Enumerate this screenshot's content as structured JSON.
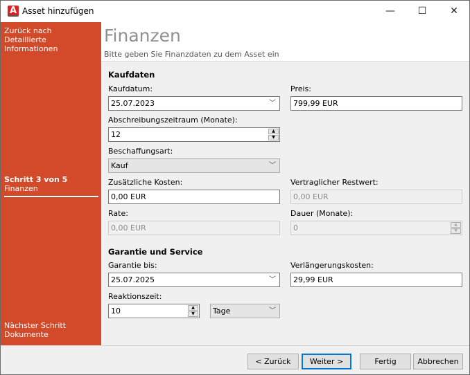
{
  "window": {
    "title": "Asset hinzufügen",
    "app_icon_letter": "A",
    "minimize": "—",
    "maximize": "☐",
    "close": "✕"
  },
  "sidebar": {
    "back_line1": "Zurück nach",
    "back_line2": "Detaillierte Informationen",
    "step": "Schritt 3 von 5",
    "step_name": "Finanzen",
    "next_label": "Nächster Schritt",
    "next_name": "Dokumente",
    "color": "#d24a2a"
  },
  "header": {
    "title": "Finanzen",
    "subtitle": "Bitte geben Sie Finanzdaten zu dem Asset ein"
  },
  "kaufdaten": {
    "section": "Kaufdaten",
    "kaufdatum_label": "Kaufdatum:",
    "kaufdatum": "25.07.2023",
    "preis_label": "Preis:",
    "preis": "799,99 EUR",
    "abschreibung_label": "Abschreibungszeitraum (Monate):",
    "abschreibung": "12",
    "beschaffungsart_label": "Beschaffungsart:",
    "beschaffungsart": "Kauf",
    "zusatz_label": "Zusätzliche Kosten:",
    "zusatz": "0,00 EUR",
    "restwert_label": "Vertraglicher Restwert:",
    "restwert": "0,00 EUR",
    "rate_label": "Rate:",
    "rate": "0,00 EUR",
    "dauer_label": "Dauer (Monate):",
    "dauer": "0"
  },
  "garantie": {
    "section": "Garantie und Service",
    "garantie_bis_label": "Garantie bis:",
    "garantie_bis": "25.07.2025",
    "verlaengerung_label": "Verlängerungskosten:",
    "verlaengerung": "29,99 EUR",
    "reaktionszeit_label": "Reaktionszeit:",
    "reaktionszeit": "10",
    "einheit": "Tage"
  },
  "footer": {
    "back": "< Zurück",
    "next": "Weiter >",
    "finish": "Fertig",
    "cancel": "Abbrechen"
  }
}
